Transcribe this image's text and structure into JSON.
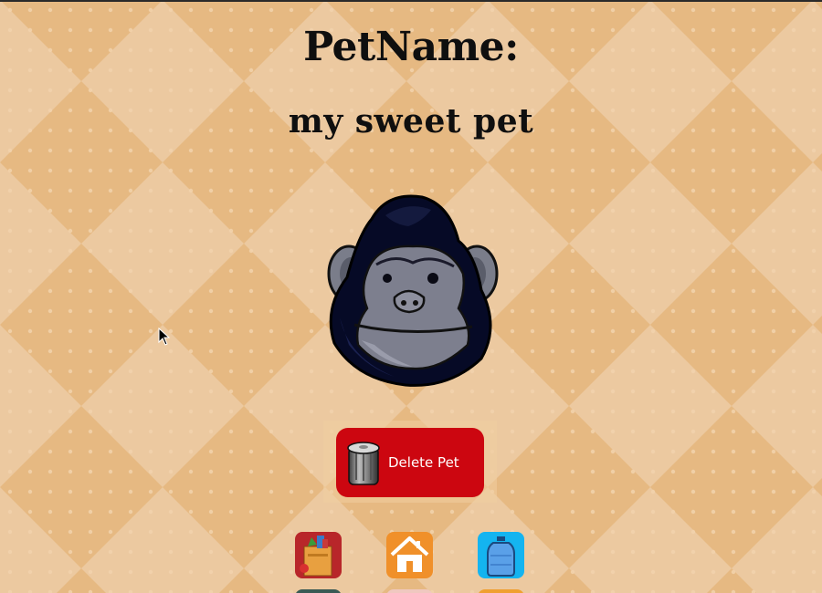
{
  "header": {
    "title": "PetName:",
    "pet_name": "my sweet pet"
  },
  "pet": {
    "icon": "gorilla-face-icon"
  },
  "delete_button": {
    "label": "Delete Pet",
    "icon": "trash-can-icon",
    "color": "#cc0610"
  },
  "nav": {
    "items": [
      {
        "icon": "grocery-bag-icon",
        "color": "#b8262a"
      },
      {
        "icon": "home-icon",
        "color": "#f0902a"
      },
      {
        "icon": "water-bottle-icon",
        "color": "#14b4f0"
      }
    ]
  },
  "colors": {
    "background": "#e6b982",
    "background_light": "#ecc9a0"
  }
}
